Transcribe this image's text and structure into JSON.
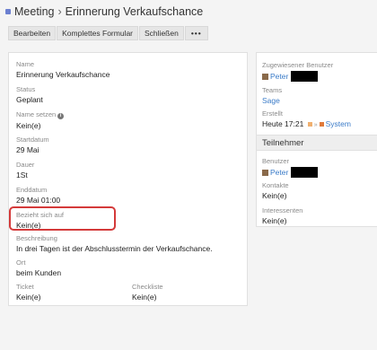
{
  "header": {
    "module": "Meeting",
    "separator": "›",
    "record_name": "Erinnerung Verkaufschance"
  },
  "toolbar": {
    "edit": "Bearbeiten",
    "full_form": "Komplettes Formular",
    "close": "Schließen",
    "more": "•••"
  },
  "details": {
    "name_label": "Name",
    "name_value": "Erinnerung Verkaufschance",
    "status_label": "Status",
    "status_value": "Geplant",
    "name_set_label": "Name setzen",
    "name_set_value": "Kein(e)",
    "start_label": "Startdatum",
    "start_value": "29 Mai",
    "duration_label": "Dauer",
    "duration_value": "1St",
    "end_label": "Enddatum",
    "end_value": "29 Mai 01:00",
    "parent_label": "Bezieht sich auf",
    "parent_value": "Kein(e)",
    "description_label": "Beschreibung",
    "description_value": "In drei Tagen ist der Abschlusstermin der Verkaufschance.",
    "location_label": "Ort",
    "location_value": "beim Kunden",
    "ticket_label": "Ticket",
    "ticket_value": "Kein(e)",
    "checklist_label": "Checkliste",
    "checklist_value": "Kein(e)"
  },
  "side": {
    "assigned_label": "Zugewiesener Benutzer",
    "assigned_user": "Peter",
    "teams_label": "Teams",
    "teams_value": "Sage",
    "created_label": "Erstellt",
    "created_time": "Heute 17:21",
    "created_sep": "»",
    "created_by": "System",
    "participants_header": "Teilnehmer",
    "users_label": "Benutzer",
    "users_value": "Peter",
    "contacts_label": "Kontakte",
    "contacts_value": "Kein(e)",
    "leads_label": "Interessenten",
    "leads_value": "Kein(e)"
  },
  "colors": {
    "accent": "#3a7bc8",
    "highlight": "#d43a3a",
    "module_dot": "#6b7fd0"
  }
}
